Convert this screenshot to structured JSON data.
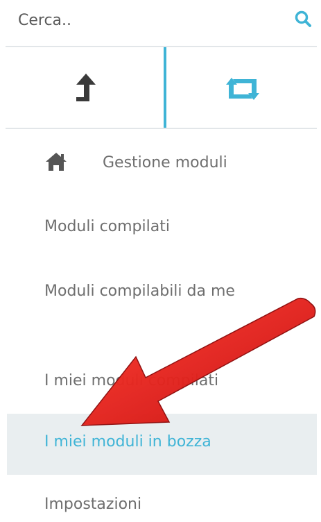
{
  "search": {
    "placeholder": "Cerca.."
  },
  "menu": {
    "home": "Gestione moduli",
    "items": [
      "Moduli compilati",
      "Moduli compilabili da me",
      "I miei moduli compilati",
      "I miei moduli in bozza",
      "Impostazioni"
    ],
    "active_index": 3
  },
  "icons": {
    "search": "search-icon",
    "upload": "upload-arrow-icon",
    "sync": "retweet-icon",
    "home": "home-icon",
    "annotation": "red-arrow"
  },
  "colors": {
    "accent": "#3fb4d6",
    "active_bg": "#e9eef0",
    "text": "#6e6e6e",
    "arrow": "#e31b1b"
  }
}
